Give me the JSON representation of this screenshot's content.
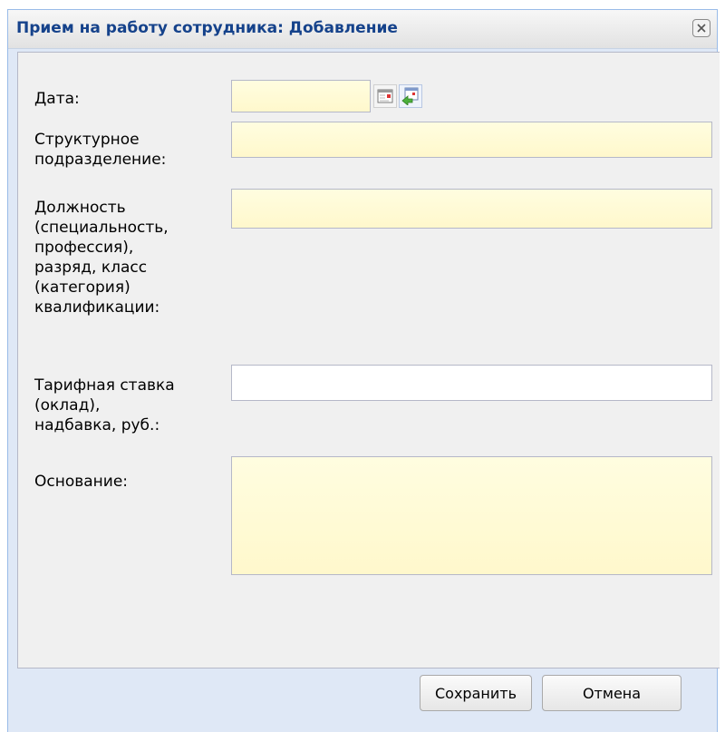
{
  "dialog": {
    "title": "Прием на работу сотрудника: Добавление"
  },
  "form": {
    "date": {
      "label": "Дата:",
      "value": ""
    },
    "department": {
      "label": "Структурное\nподразделение:",
      "value": ""
    },
    "position": {
      "label": "Должность\n(специальность,\nпрофессия),\nразряд, класс\n(категория)\nквалификации:",
      "value": ""
    },
    "tariff": {
      "label": "Тарифная ставка\n(оклад),\nнадбавка, руб.:",
      "value": ""
    },
    "basis": {
      "label": "Основание:",
      "value": ""
    }
  },
  "buttons": {
    "save": "Сохранить",
    "cancel": "Отмена"
  },
  "icons": {
    "close": "close-icon",
    "calendar": "calendar-icon",
    "calendar_pick": "calendar-select-icon"
  }
}
